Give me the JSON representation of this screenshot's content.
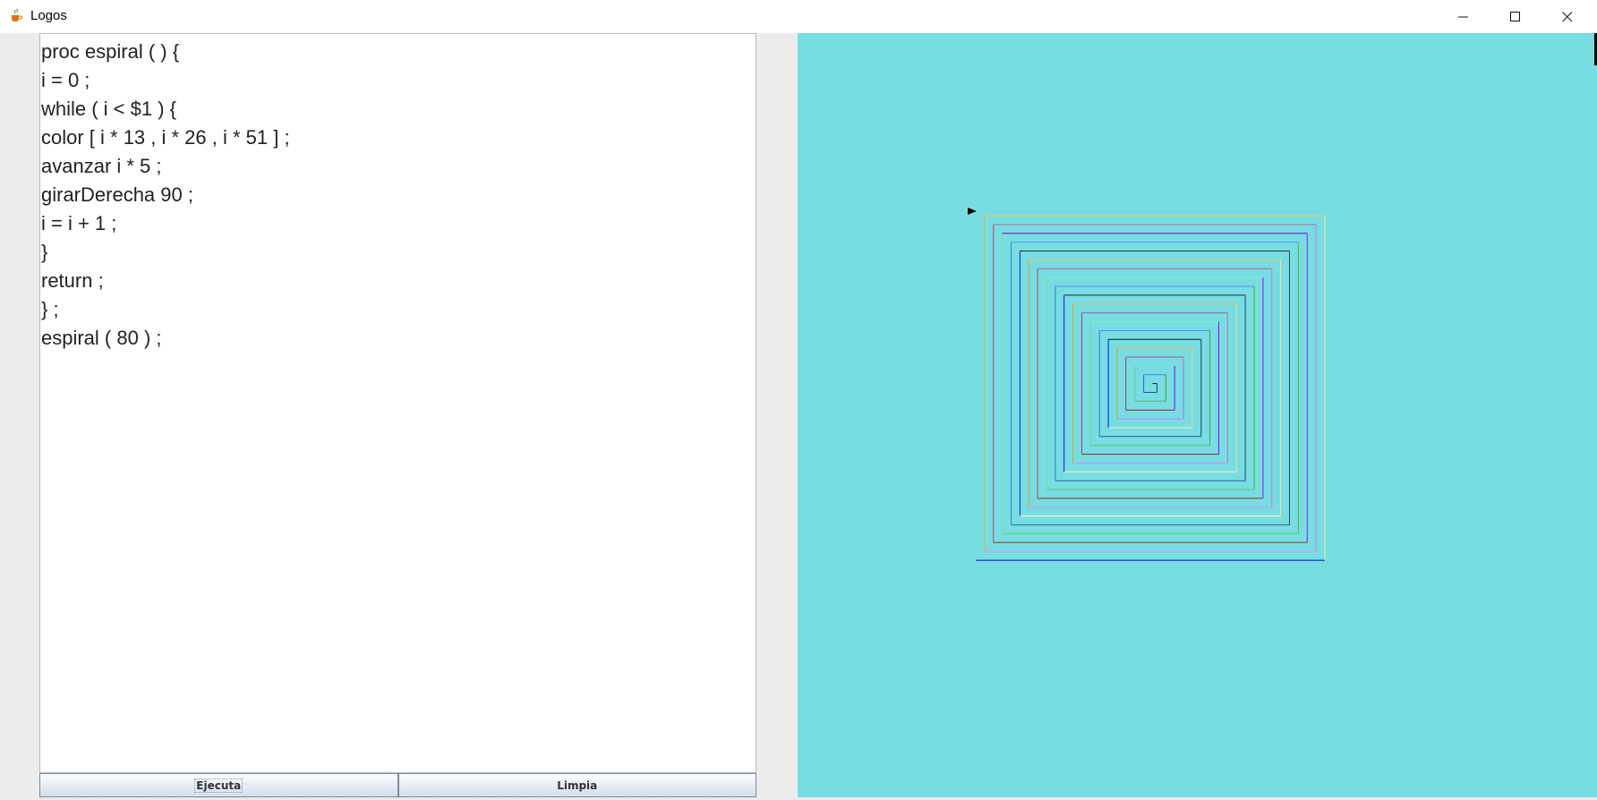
{
  "window": {
    "title": "Logos",
    "minimize_icon": "minimize-icon",
    "maximize_icon": "maximize-icon",
    "close_icon": "close-icon",
    "app_icon": "java-cup-icon"
  },
  "editor": {
    "lines": [
      "proc espiral ( ) {",
      "i = 0 ;",
      "while ( i < $1 ) {",
      "color [ i * 13 , i * 26 , i * 51 ] ;",
      "avanzar i * 5 ;",
      "girarDerecha 90 ;",
      "i = i + 1 ;",
      "}",
      "return ;",
      "} ;",
      "espiral ( 80 ) ;"
    ]
  },
  "buttons": {
    "run_label": "Ejecuta",
    "clear_label": "Limpia"
  },
  "canvas": {
    "background": "#78dde2",
    "turtle_icon": "turtle-arrow-icon",
    "spiral": {
      "iterations": 80,
      "step_multiplier": 5,
      "turn_degrees": 90,
      "color_factors": [
        13,
        26,
        51
      ]
    }
  },
  "colors": {
    "title_bar": "#ffffff",
    "frame": "#ececec",
    "editor_bg": "#ffffff",
    "canvas_bg": "#78dde2"
  }
}
